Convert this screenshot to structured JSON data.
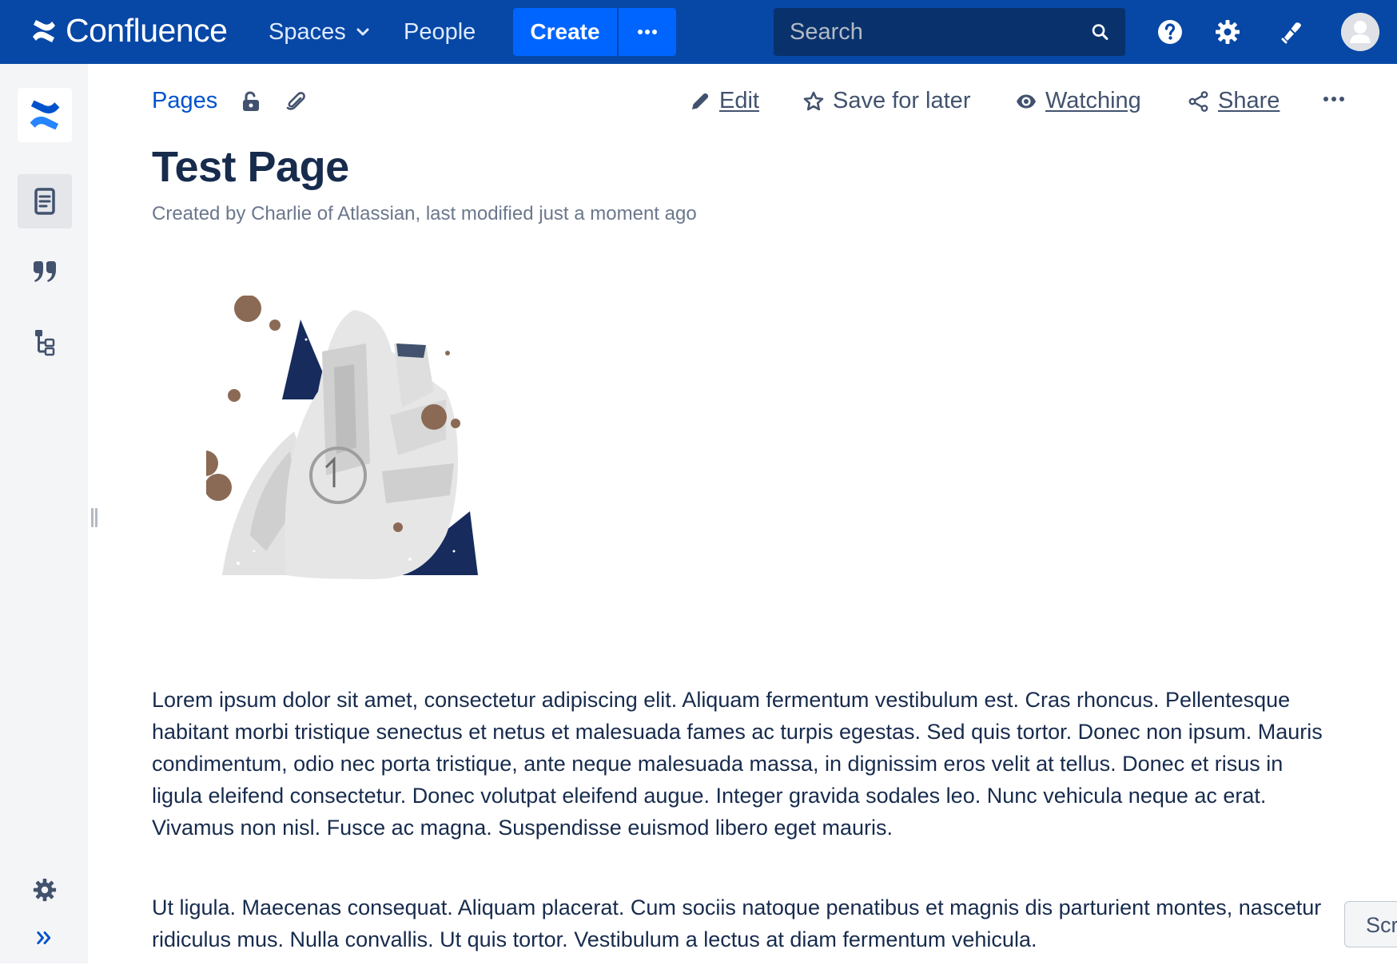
{
  "topnav": {
    "brand": "Confluence",
    "spaces_label": "Spaces",
    "people_label": "People",
    "create_label": "Create",
    "search_placeholder": "Search",
    "icons": [
      "confluence-logo-icon",
      "chevron-down-icon",
      "more-icon",
      "search-icon",
      "help-icon",
      "settings-icon",
      "notifications-icon",
      "avatar-icon"
    ],
    "bg_color": "#0747a6",
    "accent_color": "#0065ff"
  },
  "sidebar": {
    "items": [
      "space-logo",
      "pages-icon",
      "blog-quote-icon",
      "page-tree-icon",
      "space-settings-icon",
      "expand-sidebar-icon"
    ]
  },
  "breadcrumb": {
    "pages_label": "Pages"
  },
  "actions": {
    "edit": "Edit",
    "save_for_later": "Save for later",
    "watching": "Watching",
    "share": "Share"
  },
  "page": {
    "title": "Test Page",
    "byline": "Created by Charlie of Atlassian, last modified just a moment ago",
    "paragraphs": [
      "Lorem ipsum dolor sit amet, consectetur adipiscing elit. Aliquam fermentum vestibulum est. Cras rhoncus. Pellentesque habitant morbi tristique senectus et netus et malesuada fames ac turpis egestas. Sed quis tortor. Donec non ipsum. Mauris condimentum, odio nec porta tristique, ante neque malesuada massa, in dignissim eros velit at tellus. Donec et risus in ligula eleifend consectetur. Donec volutpat eleifend augue. Integer gravida sodales leo. Nunc vehicula neque ac erat. Vivamus non nisl. Fusce ac magna. Suspendisse euismod libero eget mauris.",
      "Ut ligula. Maecenas consequat. Aliquam placerat. Cum sociis natoque penatibus et magnis dis parturient montes, nascetur ridiculus mus. Nulla convallis. Ut quis tortor. Vestibulum a lectus at diam fermentum vehicula."
    ]
  },
  "scroll_hint": "Scr"
}
